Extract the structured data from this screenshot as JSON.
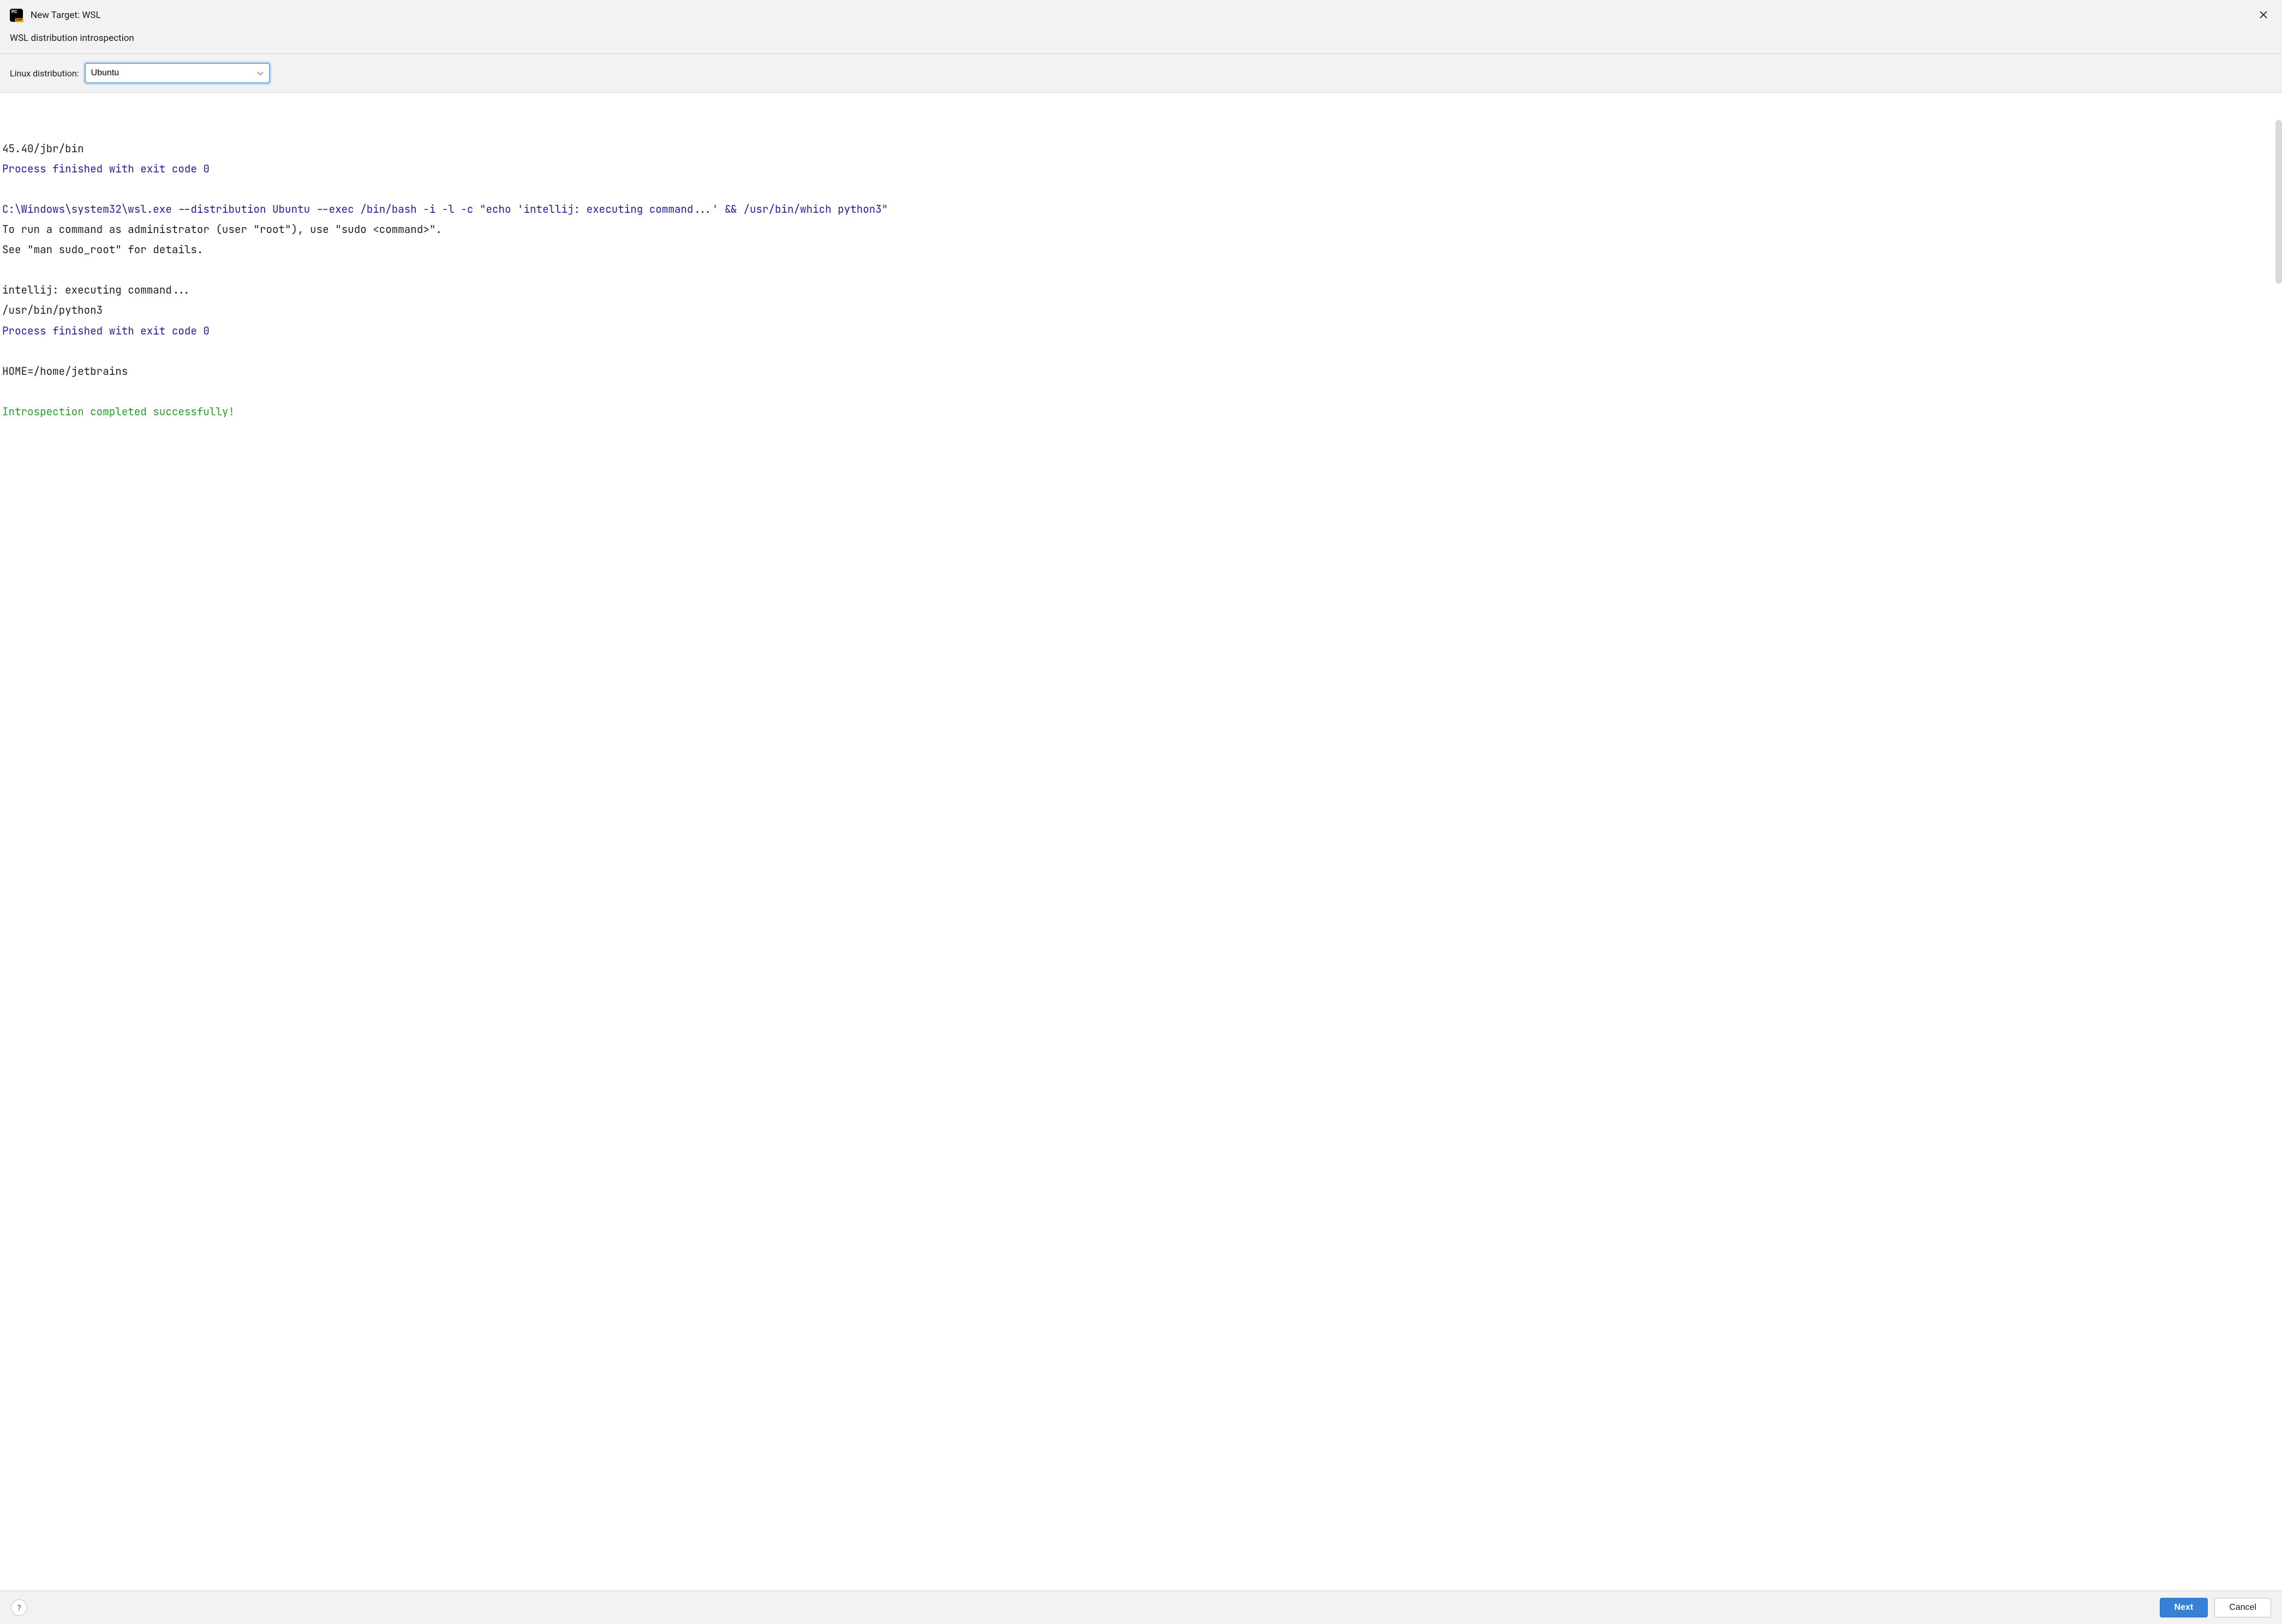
{
  "titlebar": {
    "app_icon_text": "PC",
    "app_icon_badge": "EAP",
    "title": "New Target: WSL"
  },
  "subtitle": "WSL distribution introspection",
  "form": {
    "linux_distribution_label": "Linux distribution:",
    "linux_distribution_value": "Ubuntu"
  },
  "console": {
    "lines": [
      {
        "cls": "c-black",
        "text": "45.40/jbr/bin"
      },
      {
        "cls": "c-blue",
        "text": "Process finished with exit code 0"
      },
      {
        "cls": "c-black",
        "text": ""
      },
      {
        "cls": "c-blue",
        "text": "C:\\Windows\\system32\\wsl.exe --distribution Ubuntu --exec /bin/bash -i -l -c \"echo 'intellij: executing command...' && /usr/bin/which python3\""
      },
      {
        "cls": "c-black",
        "text": "To run a command as administrator (user \"root\"), use \"sudo <command>\"."
      },
      {
        "cls": "c-black",
        "text": "See \"man sudo_root\" for details."
      },
      {
        "cls": "c-black",
        "text": ""
      },
      {
        "cls": "c-black",
        "text": "intellij: executing command..."
      },
      {
        "cls": "c-black",
        "text": "/usr/bin/python3"
      },
      {
        "cls": "c-blue",
        "text": "Process finished with exit code 0"
      },
      {
        "cls": "c-black",
        "text": ""
      },
      {
        "cls": "c-black",
        "text": "HOME=/home/jetbrains"
      },
      {
        "cls": "c-black",
        "text": ""
      },
      {
        "cls": "c-green",
        "text": "Introspection completed successfully!"
      }
    ]
  },
  "footer": {
    "help": "?",
    "next": "Next",
    "cancel": "Cancel"
  }
}
